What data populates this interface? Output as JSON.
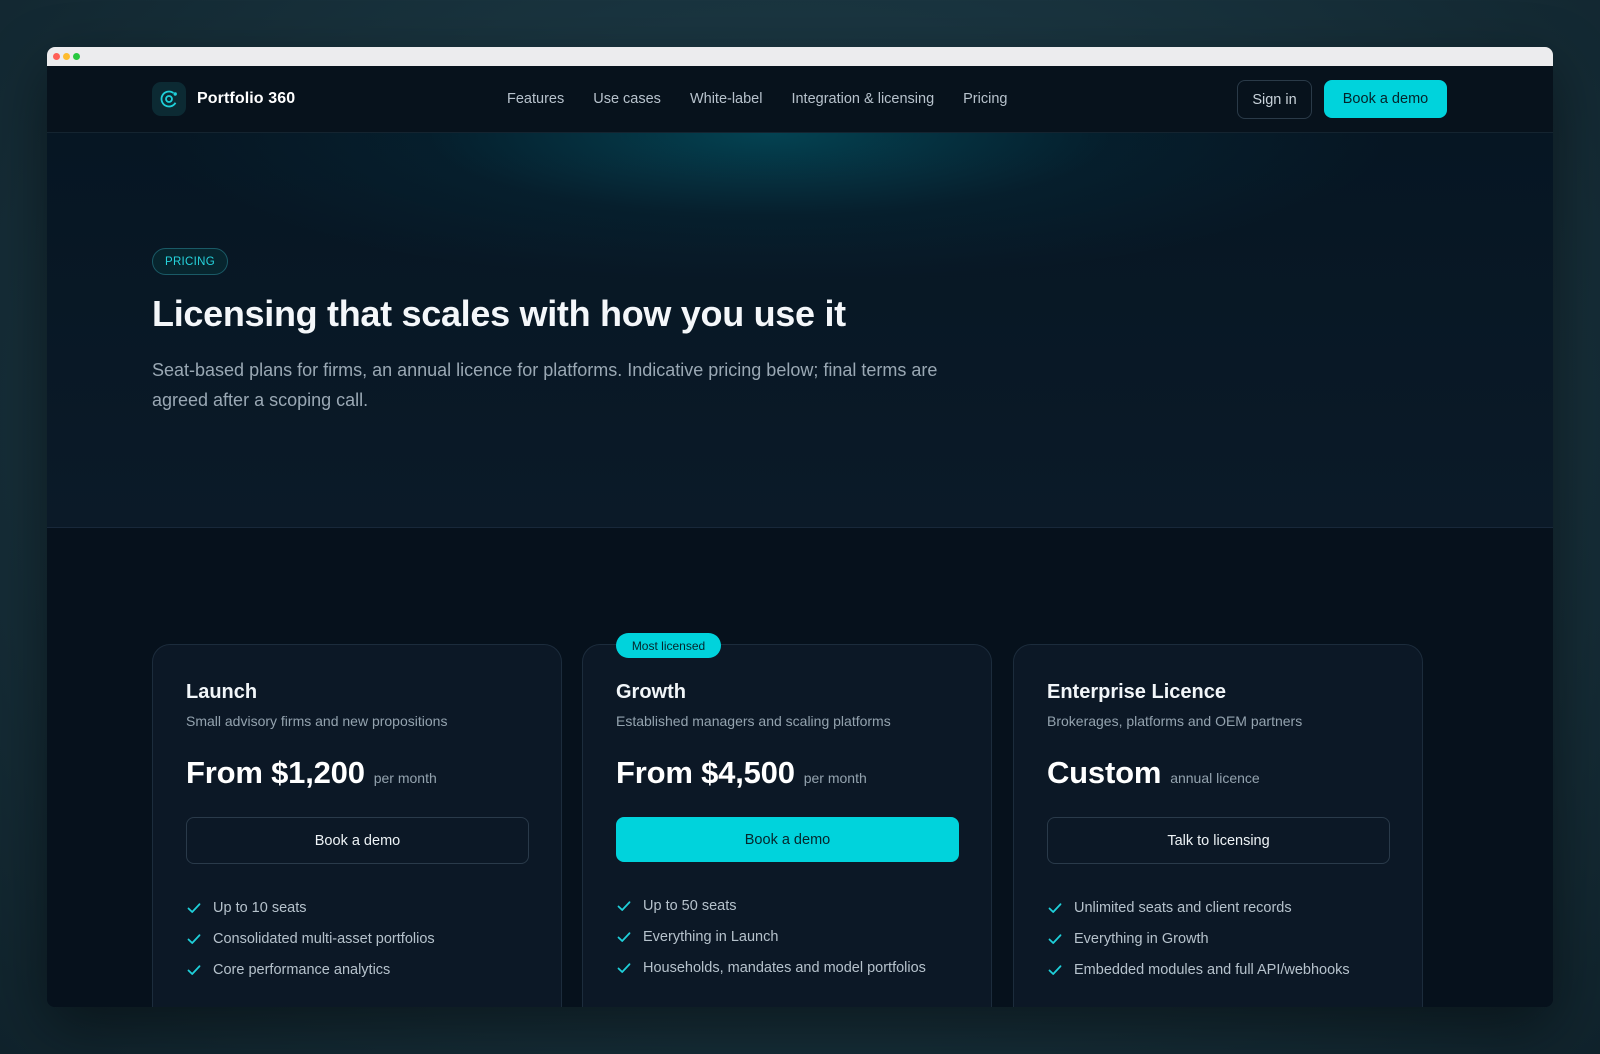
{
  "brand": {
    "name": "Portfolio 360",
    "logo_icon": "orbit-logo-icon",
    "accent": "#00d3dc"
  },
  "nav": {
    "links": [
      "Features",
      "Use cases",
      "White-label",
      "Integration & licensing",
      "Pricing"
    ],
    "sign_in": "Sign in",
    "book_demo": "Book a demo"
  },
  "hero": {
    "eyebrow": "PRICING",
    "title": "Licensing that scales with how you use it",
    "subtitle": "Seat-based plans for firms, an annual licence for platforms. Indicative pricing below; final terms are agreed after a scoping call."
  },
  "plans": [
    {
      "name": "Launch",
      "description": "Small advisory firms and new propositions",
      "price": "From $1,200",
      "period": "per month",
      "cta": "Book a demo",
      "features": [
        "Up to 10 seats",
        "Consolidated multi-asset portfolios",
        "Core performance analytics"
      ]
    },
    {
      "badge": "Most licensed",
      "name": "Growth",
      "description": "Established managers and scaling platforms",
      "price": "From $4,500",
      "period": "per month",
      "cta": "Book a demo",
      "features": [
        "Up to 50 seats",
        "Everything in Launch",
        "Households, mandates and model portfolios"
      ]
    },
    {
      "name": "Enterprise Licence",
      "description": "Brokerages, platforms and OEM partners",
      "price": "Custom",
      "period": "annual licence",
      "cta": "Talk to licensing",
      "features": [
        "Unlimited seats and client records",
        "Everything in Growth",
        "Embedded modules and full API/webhooks"
      ]
    }
  ],
  "icons": {
    "feature_check": "check-icon"
  }
}
